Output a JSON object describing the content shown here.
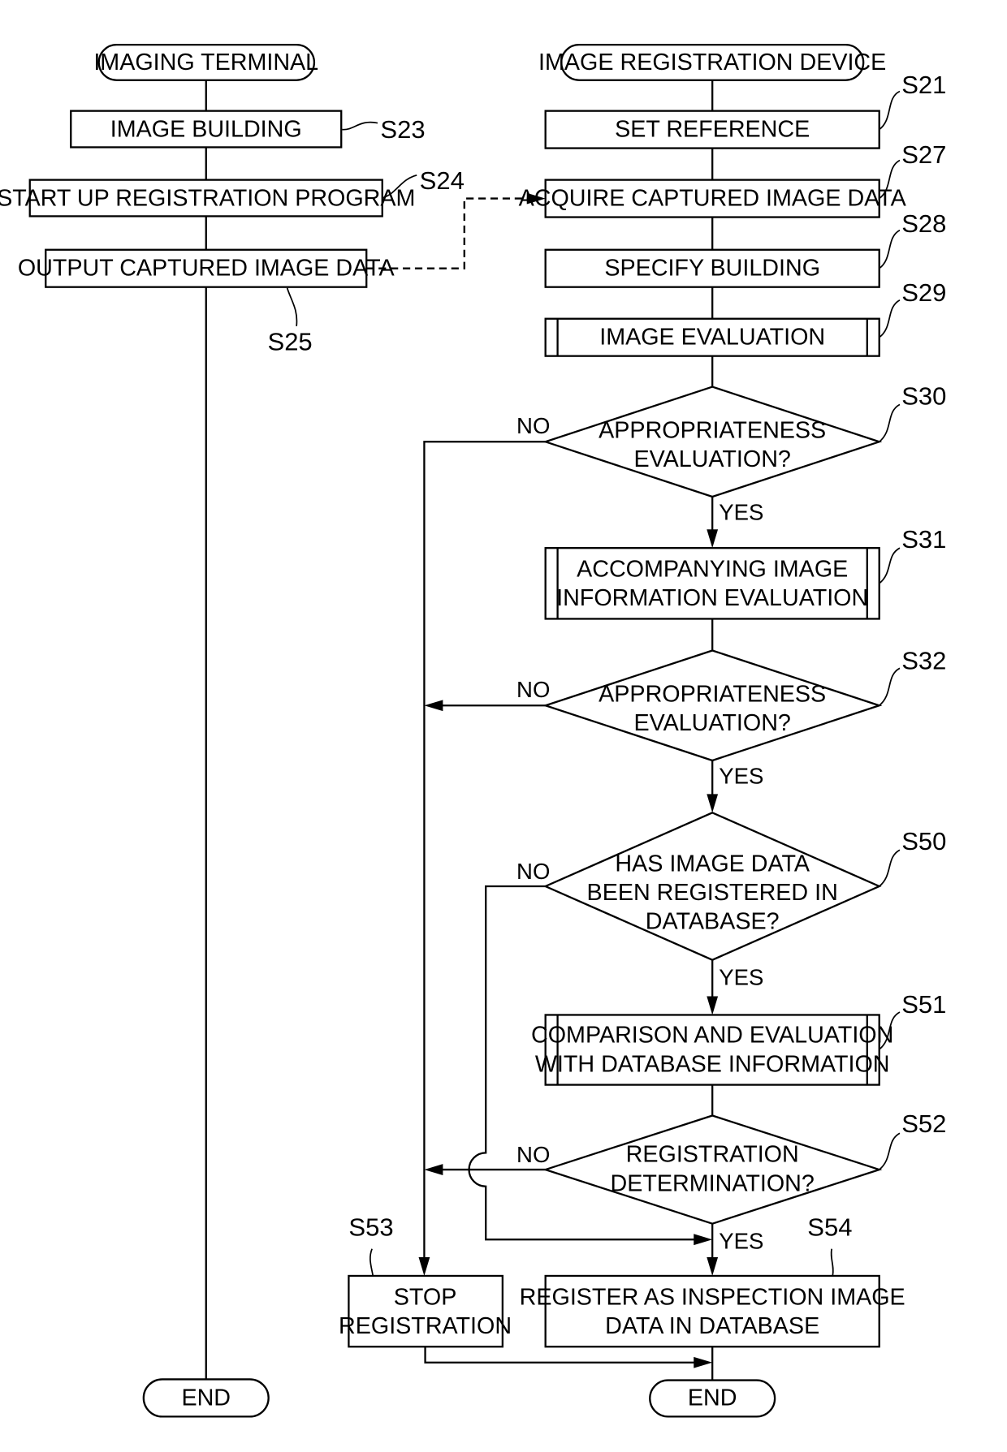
{
  "diagram": {
    "type": "flowchart",
    "lanes": {
      "left": {
        "title": "IMAGING TERMINAL"
      },
      "right": {
        "title": "IMAGE REGISTRATION DEVICE"
      }
    },
    "nodes": {
      "s23": {
        "id": "S23",
        "lines": [
          "IMAGE BUILDING"
        ]
      },
      "s24": {
        "id": "S24",
        "lines": [
          "START UP REGISTRATION PROGRAM"
        ]
      },
      "s25": {
        "id": "S25",
        "lines": [
          "OUTPUT CAPTURED IMAGE DATA"
        ]
      },
      "end_left": {
        "lines": [
          "END"
        ]
      },
      "s21": {
        "id": "S21",
        "lines": [
          "SET REFERENCE"
        ]
      },
      "s27": {
        "id": "S27",
        "lines": [
          "ACQUIRE CAPTURED IMAGE DATA"
        ]
      },
      "s28": {
        "id": "S28",
        "lines": [
          "SPECIFY BUILDING"
        ]
      },
      "s29": {
        "id": "S29",
        "lines": [
          "IMAGE EVALUATION"
        ]
      },
      "s30": {
        "id": "S30",
        "lines": [
          "APPROPRIATENESS",
          "EVALUATION?"
        ]
      },
      "s31": {
        "id": "S31",
        "lines": [
          "ACCOMPANYING IMAGE",
          "INFORMATION EVALUATION"
        ]
      },
      "s32": {
        "id": "S32",
        "lines": [
          "APPROPRIATENESS",
          "EVALUATION?"
        ]
      },
      "s50": {
        "id": "S50",
        "lines": [
          "HAS IMAGE DATA",
          "BEEN REGISTERED IN",
          "DATABASE?"
        ]
      },
      "s51": {
        "id": "S51",
        "lines": [
          "COMPARISON AND EVALUATION",
          "WITH DATABASE INFORMATION"
        ]
      },
      "s52": {
        "id": "S52",
        "lines": [
          "REGISTRATION",
          "DETERMINATION?"
        ]
      },
      "s53": {
        "id": "S53",
        "lines": [
          "STOP",
          "REGISTRATION"
        ]
      },
      "s54": {
        "id": "S54",
        "lines": [
          "REGISTER AS INSPECTION IMAGE",
          "DATA IN DATABASE"
        ]
      },
      "end_right": {
        "lines": [
          "END"
        ]
      }
    },
    "branch_labels": {
      "yes": "YES",
      "no": "NO"
    }
  }
}
